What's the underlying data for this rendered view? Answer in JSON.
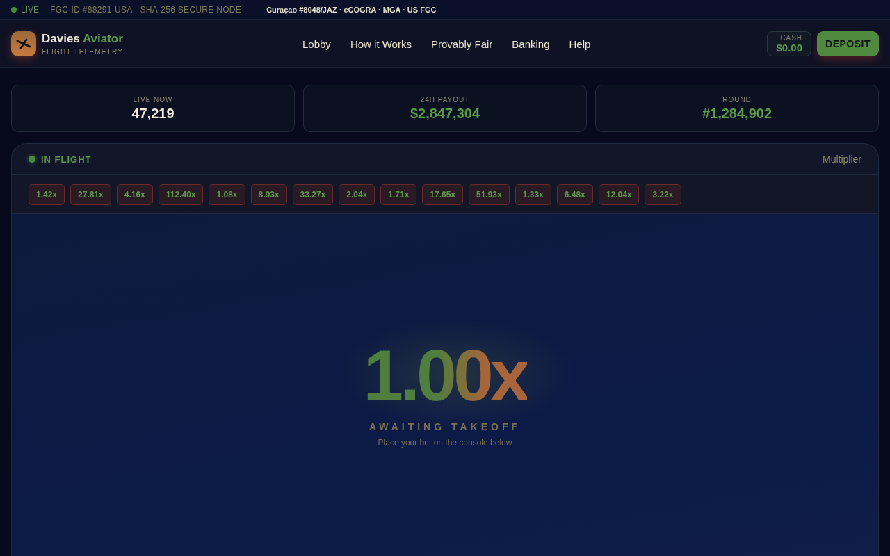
{
  "top_bar": {
    "live_label": "LIVE",
    "node_id": "FGC-ID #88291-USA · SHA-256 SECURE NODE",
    "separator": "·",
    "licenses": "Curaçao #8048/JAZ · eCOGRA · MGA · US FGC"
  },
  "header": {
    "brand": {
      "name": "Davies",
      "accent": "Aviator",
      "subtitle": "FLIGHT TELEMETRY"
    },
    "nav": [
      "Lobby",
      "How it Works",
      "Provably Fair",
      "Banking",
      "Help"
    ],
    "cash": {
      "label": "CASH",
      "value": "$0.00"
    },
    "deposit_button": "DEPOSIT"
  },
  "stats": [
    {
      "label": "LIVE NOW",
      "value": "47,219",
      "accent": false
    },
    {
      "label": "24H PAYOUT",
      "value": "$2,847,304",
      "accent": true
    },
    {
      "label": "ROUND",
      "value": "#1,284,902",
      "accent": true
    }
  ],
  "flight_panel": {
    "status": "IN FLIGHT",
    "title": "Multiplier",
    "history": [
      "1.42x",
      "27.81x",
      "4.16x",
      "112.40x",
      "1.08x",
      "8.93x",
      "33.27x",
      "2.04x",
      "1.71x",
      "17.65x",
      "51.93x",
      "1.33x",
      "6.48x",
      "12.04x",
      "3.22x"
    ],
    "multiplier": "1.00x",
    "state": "AWAITING TAKEOFF",
    "hint": "Place your bet on the console below"
  }
}
